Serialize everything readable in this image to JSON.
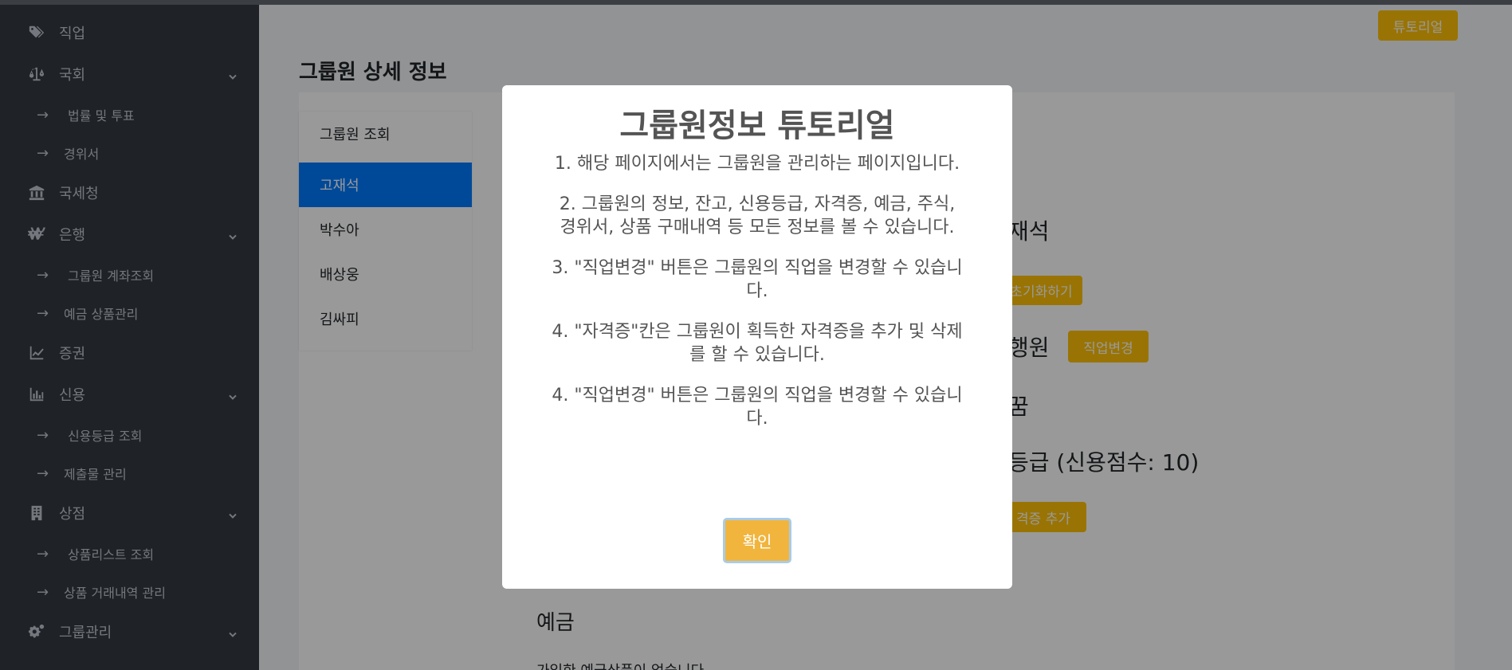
{
  "sidebar": {
    "items": [
      {
        "label": "직업",
        "icon": "tags-icon"
      },
      {
        "label": "국회",
        "icon": "balance-scale-icon"
      },
      {
        "label": "법률 및 투표"
      },
      {
        "label": "경위서"
      },
      {
        "label": "국세청",
        "icon": "landmark-icon"
      },
      {
        "label": "은행",
        "icon": "won-sign-icon"
      },
      {
        "label": "그룹원 계좌조회"
      },
      {
        "label": "예금 상품관리"
      },
      {
        "label": "증권",
        "icon": "chart-line-icon"
      },
      {
        "label": "신용",
        "icon": "chart-bar-icon"
      },
      {
        "label": "신용등급 조회"
      },
      {
        "label": "제출물 관리"
      },
      {
        "label": "상점",
        "icon": "store-building-icon"
      },
      {
        "label": "상품리스트 조회"
      },
      {
        "label": "상품 거래내역 관리"
      },
      {
        "label": "그룹관리",
        "icon": "gears-icon"
      }
    ],
    "arrow": "→"
  },
  "header": {
    "tutorial_label": "튜토리얼"
  },
  "main": {
    "title": "그룹원 상세 정보",
    "members": [
      "그룹원 조회",
      "고재석",
      "박수아",
      "배상웅",
      "김싸피"
    ],
    "selected_member": "고재석",
    "detail": {
      "name_partial": "재석",
      "reset_button_partial": "초기화하기",
      "job_partial": "행원",
      "change_job_label": "직업변경",
      "item_partial": "꿈",
      "credit_partial": "등급 (신용점수: 10)",
      "add_cert_partial": "격증 추가",
      "deposit_heading": "예금",
      "deposit_empty_partial": "가입한 예금상품이 없습니다"
    }
  },
  "modal": {
    "title": "그룹원정보 튜토리얼",
    "steps": [
      "1. 해당 페이지에서는 그룹원을 관리하는 페이지입니다.",
      "2. 그룹원의 정보, 잔고, 신용등급, 자격증, 예금, 주식, 경위서, 상품 구매내역 등 모든 정보를 볼 수 있습니다.",
      "3. \"직업변경\" 버튼은 그룹원의 직업을 변경할 수 있습니다.",
      "4. \"자격증\"칸은 그룹원이 획득한 자격증을 추가 및 삭제를 할 수 있습니다.",
      "4. \"직업변경\" 버튼은 그룹원의 직업을 변경할 수 있습니다."
    ],
    "confirm_label": "확인"
  },
  "colors": {
    "sidebar_bg": "#343a40",
    "accent_yellow": "#ffc107",
    "active_blue": "#007bff",
    "confirm_btn": "#f1b53d"
  }
}
